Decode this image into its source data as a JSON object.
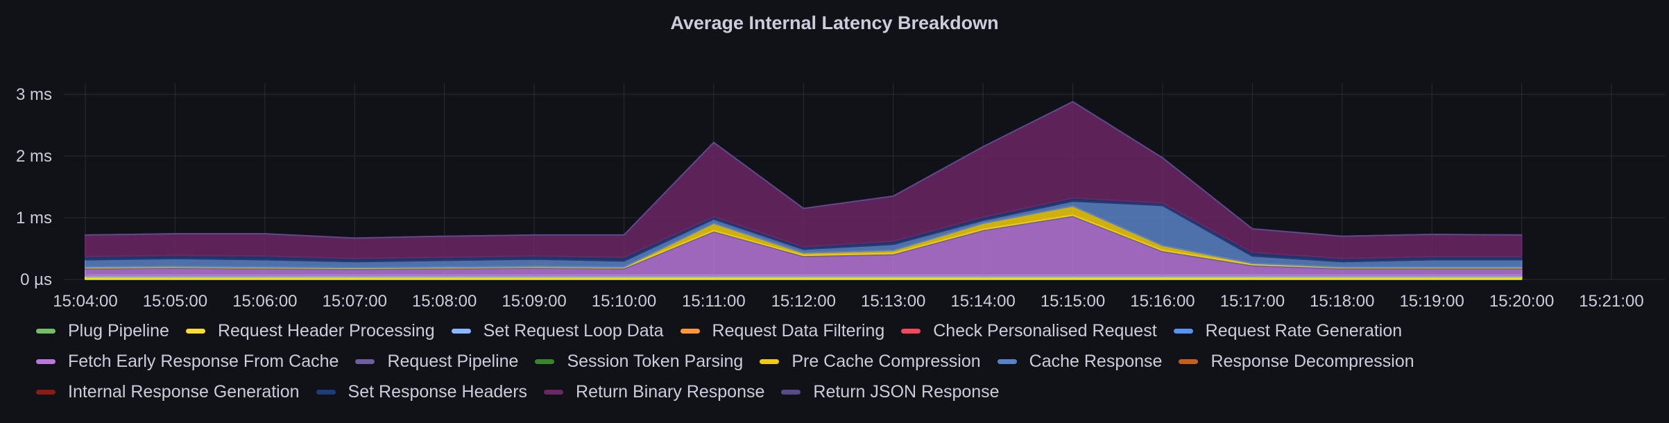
{
  "chart_data": {
    "type": "area",
    "stacked": true,
    "title": "Average Internal Latency Breakdown",
    "xlabel": "",
    "ylabel": "",
    "x": [
      "15:04:00",
      "15:05:00",
      "15:06:00",
      "15:07:00",
      "15:08:00",
      "15:09:00",
      "15:10:00",
      "15:11:00",
      "15:12:00",
      "15:13:00",
      "15:14:00",
      "15:15:00",
      "15:16:00",
      "15:17:00",
      "15:18:00",
      "15:19:00",
      "15:20:00"
    ],
    "x_ticks": [
      "15:04:00",
      "15:05:00",
      "15:06:00",
      "15:07:00",
      "15:08:00",
      "15:09:00",
      "15:10:00",
      "15:11:00",
      "15:12:00",
      "15:13:00",
      "15:14:00",
      "15:15:00",
      "15:16:00",
      "15:17:00",
      "15:18:00",
      "15:19:00",
      "15:20:00",
      "15:21:00"
    ],
    "y_unit": "ms",
    "ylim": [
      0,
      3.2
    ],
    "y_ticks": [
      {
        "value": 0,
        "label": "0 µs"
      },
      {
        "value": 1,
        "label": "1 ms"
      },
      {
        "value": 2,
        "label": "2 ms"
      },
      {
        "value": 3,
        "label": "3 ms"
      }
    ],
    "grid": true,
    "legend_position": "bottom",
    "series": [
      {
        "name": "Plug Pipeline",
        "color": "#73bf69",
        "values": [
          0.01,
          0.01,
          0.01,
          0.01,
          0.01,
          0.01,
          0.01,
          0.01,
          0.01,
          0.01,
          0.01,
          0.01,
          0.01,
          0.01,
          0.01,
          0.01,
          0.01
        ]
      },
      {
        "name": "Request Header Processing",
        "color": "#fade2a",
        "values": [
          0.04,
          0.04,
          0.04,
          0.04,
          0.04,
          0.04,
          0.04,
          0.04,
          0.04,
          0.04,
          0.04,
          0.04,
          0.04,
          0.04,
          0.04,
          0.04,
          0.04
        ]
      },
      {
        "name": "Set Request Loop Data",
        "color": "#8ab8ff",
        "values": [
          0.01,
          0.01,
          0.01,
          0.01,
          0.01,
          0.01,
          0.01,
          0.01,
          0.01,
          0.01,
          0.01,
          0.01,
          0.01,
          0.01,
          0.01,
          0.01,
          0.01
        ]
      },
      {
        "name": "Request Data Filtering",
        "color": "#ff9830",
        "values": [
          0,
          0,
          0,
          0,
          0,
          0,
          0,
          0,
          0,
          0,
          0,
          0,
          0,
          0,
          0,
          0,
          0
        ]
      },
      {
        "name": "Check Personalised Request",
        "color": "#f2495c",
        "values": [
          0,
          0,
          0,
          0,
          0,
          0,
          0,
          0,
          0,
          0,
          0,
          0,
          0,
          0,
          0,
          0,
          0
        ]
      },
      {
        "name": "Request Rate Generation",
        "color": "#5794f2",
        "values": [
          0.01,
          0.01,
          0.01,
          0.01,
          0.01,
          0.01,
          0.01,
          0.01,
          0.01,
          0.01,
          0.01,
          0.01,
          0.01,
          0.01,
          0.01,
          0.01,
          0.01
        ]
      },
      {
        "name": "Fetch Early Response From Cache",
        "color": "#b877d9",
        "values": [
          0.1,
          0.11,
          0.1,
          0.09,
          0.1,
          0.11,
          0.1,
          0.7,
          0.3,
          0.33,
          0.72,
          0.95,
          0.38,
          0.15,
          0.1,
          0.1,
          0.1
        ]
      },
      {
        "name": "Request Pipeline",
        "color": "#705da0",
        "values": [
          0.02,
          0.02,
          0.02,
          0.02,
          0.02,
          0.02,
          0.02,
          0.02,
          0.02,
          0.02,
          0.02,
          0.02,
          0.02,
          0.02,
          0.02,
          0.02,
          0.02
        ]
      },
      {
        "name": "Session Token Parsing",
        "color": "#37872d",
        "values": [
          0,
          0,
          0,
          0,
          0,
          0,
          0,
          0,
          0,
          0,
          0,
          0,
          0,
          0,
          0,
          0,
          0
        ]
      },
      {
        "name": "Pre Cache Compression",
        "color": "#f2cc0c",
        "values": [
          0.01,
          0.01,
          0.01,
          0.01,
          0.01,
          0.01,
          0.01,
          0.12,
          0.04,
          0.05,
          0.1,
          0.15,
          0.08,
          0.02,
          0.01,
          0.01,
          0.01
        ]
      },
      {
        "name": "Cache Response",
        "color": "#5a82c6",
        "values": [
          0.12,
          0.13,
          0.12,
          0.1,
          0.11,
          0.12,
          0.1,
          0.07,
          0.06,
          0.1,
          0.05,
          0.08,
          0.65,
          0.12,
          0.09,
          0.12,
          0.12
        ]
      },
      {
        "name": "Response Decompression",
        "color": "#c4601d",
        "values": [
          0,
          0,
          0,
          0,
          0,
          0,
          0,
          0,
          0,
          0,
          0,
          0,
          0,
          0,
          0,
          0,
          0
        ]
      },
      {
        "name": "Internal Response Generation",
        "color": "#8a1c14",
        "values": [
          0,
          0,
          0,
          0,
          0,
          0,
          0,
          0,
          0,
          0,
          0,
          0,
          0,
          0,
          0,
          0,
          0
        ]
      },
      {
        "name": "Set Response Headers",
        "color": "#1f3c7a",
        "values": [
          0.05,
          0.05,
          0.06,
          0.05,
          0.05,
          0.05,
          0.06,
          0.04,
          0.04,
          0.05,
          0.05,
          0.05,
          0.04,
          0.06,
          0.05,
          0.05,
          0.05
        ]
      },
      {
        "name": "Return Binary Response",
        "color": "#6b2764",
        "values": [
          0.35,
          0.35,
          0.36,
          0.33,
          0.34,
          0.34,
          0.36,
          1.2,
          0.62,
          0.73,
          1.14,
          1.56,
          0.73,
          0.38,
          0.36,
          0.36,
          0.35
        ]
      },
      {
        "name": "Return JSON Response",
        "color": "#5a4a8a",
        "values": [
          0,
          0,
          0,
          0,
          0,
          0,
          0,
          0,
          0,
          0,
          0,
          0,
          0,
          0,
          0,
          0,
          0
        ]
      }
    ]
  }
}
